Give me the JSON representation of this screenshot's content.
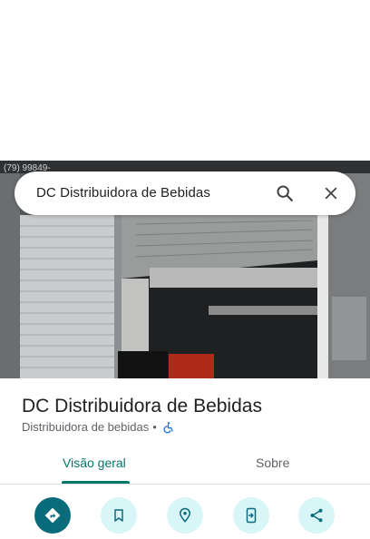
{
  "search": {
    "query": "DC Distribuidora de Bebidas"
  },
  "photo": {
    "sign_text": "(79) 99849-"
  },
  "place": {
    "name": "DC Distribuidora de Bebidas",
    "category": "Distribuidora de bebidas",
    "separator": "•",
    "wheelchair_icon": "wheelchair-accessible-icon"
  },
  "tabs": [
    {
      "label": "Visão geral",
      "active": true
    },
    {
      "label": "Sobre",
      "active": false
    }
  ],
  "actions": [
    {
      "icon": "directions-icon",
      "primary": true
    },
    {
      "icon": "save-icon",
      "primary": false
    },
    {
      "icon": "nearby-icon",
      "primary": false
    },
    {
      "icon": "send-to-phone-icon",
      "primary": false
    },
    {
      "icon": "share-icon",
      "primary": false
    }
  ],
  "colors": {
    "accent": "#00796b",
    "primary_action": "#0a6b7a",
    "action_bg": "#d8f5f7"
  }
}
